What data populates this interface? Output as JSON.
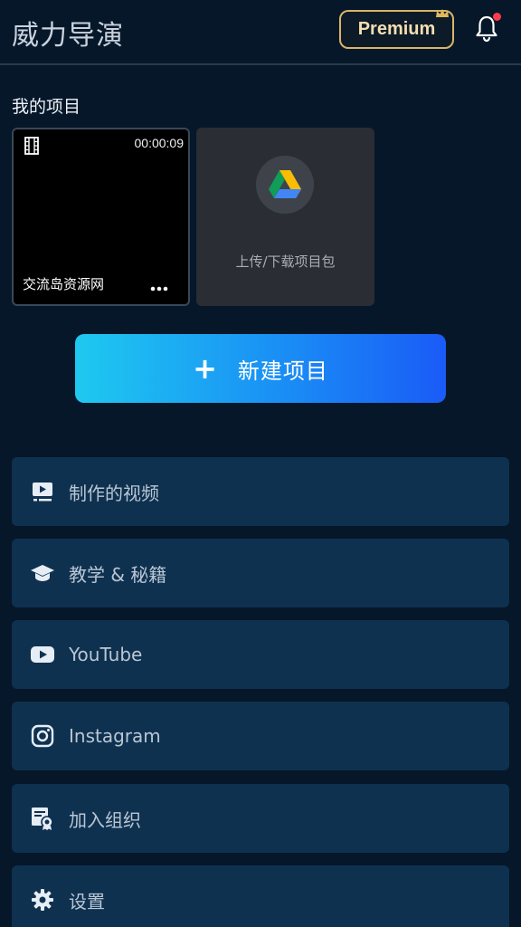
{
  "header": {
    "title": "威力导演",
    "premium_label": "Premium"
  },
  "projects": {
    "section_title": "我的项目",
    "items": [
      {
        "name": "交流岛资源网",
        "duration": "00:00:09"
      }
    ],
    "upload_label": "上传/下载项目包"
  },
  "new_project": {
    "plus": "+",
    "label": "新建项目"
  },
  "menu": [
    {
      "label": "制作的视频",
      "icon": "produced-video-icon"
    },
    {
      "label": "教学 & 秘籍",
      "icon": "graduation-cap-icon"
    },
    {
      "label": "YouTube",
      "icon": "youtube-icon"
    },
    {
      "label": "Instagram",
      "icon": "instagram-icon"
    },
    {
      "label": "加入组织",
      "icon": "certificate-icon"
    },
    {
      "label": "设置",
      "icon": "gear-icon"
    }
  ],
  "colors": {
    "background": "#06172a",
    "menu_background": "#0f3150",
    "premium_gold": "#d9b56a",
    "notification_dot": "#ff3b4c",
    "button_gradient_start": "#1ec9f0",
    "button_gradient_end": "#1a5bf7"
  }
}
